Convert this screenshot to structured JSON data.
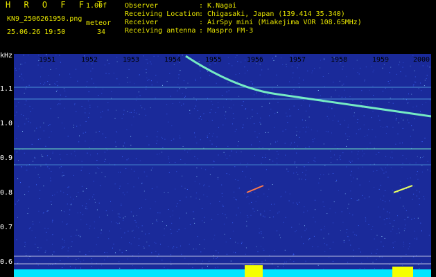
{
  "header": {
    "app_title": "H R O F F T",
    "version": "1.00f",
    "filename": "KN9_2506261950.png",
    "meteor_label": "meteor",
    "meteor_count": "34",
    "datetime": "25.06.26 19:50",
    "info": [
      {
        "key": "Observer",
        "value": ": K.Nagai"
      },
      {
        "key": "Receiving Location",
        "value": ": Chigasaki, Japan (139.414 35.340)"
      },
      {
        "key": "Receiver",
        "value": ": AirSpy mini (Miakejima VOR 108.65MHz)"
      },
      {
        "key": "Receiving antenna",
        "value": ": Maspro FM-3"
      }
    ]
  },
  "axis": {
    "y_unit": "kHz",
    "y_ticks": [
      "1.1",
      "1.0",
      "0.9",
      "0.8",
      "0.7",
      "0.6"
    ],
    "x_ticks": [
      "1951",
      "1952",
      "1953",
      "1954",
      "1955",
      "1956",
      "1957",
      "1958",
      "1959",
      "2000"
    ]
  },
  "colors": {
    "background": "#000000",
    "spectrogram_bg": "#1a2a9a",
    "noise_points": "#3c66ff",
    "trace": "#7fffc8",
    "signal_floor": "#00e5ff",
    "signal_bursts": "#f5ff00",
    "header_text": "#e8e600",
    "axis_text": "#ffffff"
  }
}
